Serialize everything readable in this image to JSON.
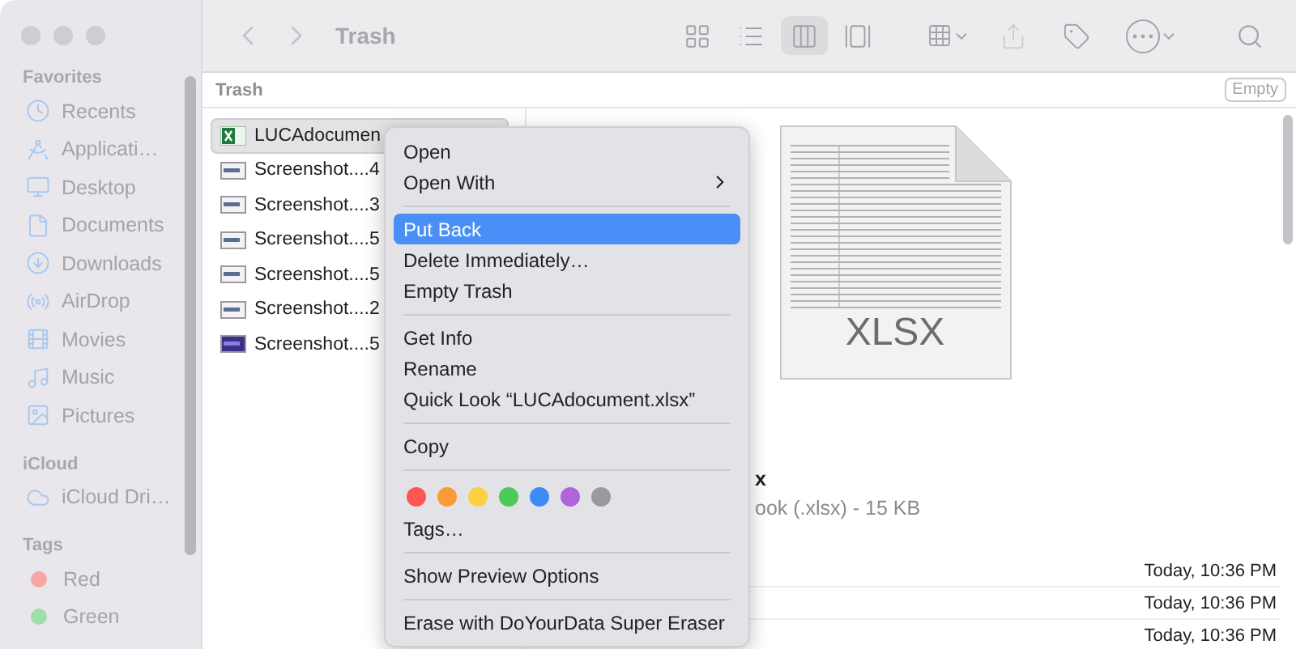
{
  "window": {
    "title": "Trash"
  },
  "toolbar": {
    "views": [
      {
        "kind": "icons",
        "selected": false
      },
      {
        "kind": "list",
        "selected": false
      },
      {
        "kind": "columns",
        "selected": true
      },
      {
        "kind": "gallery",
        "selected": false
      }
    ]
  },
  "sidebar": {
    "sections": [
      {
        "title": "Favorites",
        "items": [
          {
            "label": "Recents",
            "kind": "recents"
          },
          {
            "label": "Applicati…",
            "kind": "applications"
          },
          {
            "label": "Desktop",
            "kind": "desktop"
          },
          {
            "label": "Documents",
            "kind": "documents"
          },
          {
            "label": "Downloads",
            "kind": "downloads"
          },
          {
            "label": "AirDrop",
            "kind": "airdrop"
          },
          {
            "label": "Movies",
            "kind": "movies"
          },
          {
            "label": "Music",
            "kind": "music"
          },
          {
            "label": "Pictures",
            "kind": "pictures"
          }
        ]
      },
      {
        "title": "iCloud",
        "items": [
          {
            "label": "iCloud Dri…",
            "kind": "cloud"
          }
        ]
      },
      {
        "title": "Tags",
        "items": [
          {
            "label": "Red",
            "kind": "tag",
            "color": "#f7a5a5"
          },
          {
            "label": "Green",
            "kind": "tag",
            "color": "#9fdea8"
          }
        ]
      }
    ]
  },
  "path_bar": {
    "title": "Trash",
    "button": "Empty"
  },
  "files": [
    {
      "name": "LUCAdocumen",
      "kind": "spreadsheet",
      "selected": true
    },
    {
      "name": "Screenshot....4",
      "kind": "screenshot",
      "selected": false
    },
    {
      "name": "Screenshot....3",
      "kind": "screenshot",
      "selected": false
    },
    {
      "name": "Screenshot....5",
      "kind": "screenshot",
      "selected": false
    },
    {
      "name": "Screenshot....5",
      "kind": "screenshot",
      "selected": false
    },
    {
      "name": "Screenshot....2",
      "kind": "screenshot",
      "selected": false
    },
    {
      "name": "Screenshot....5",
      "kind": "screenshot-dark",
      "selected": false
    }
  ],
  "preview": {
    "icon_label": "XLSX",
    "name": "x",
    "info": "ook (.xlsx) - 15 KB",
    "dates": [
      "Today, 10:36 PM",
      "Today, 10:36 PM",
      "Today, 10:36 PM"
    ]
  },
  "context_menu": {
    "items": [
      {
        "kind": "item",
        "label": "Open",
        "selected": false
      },
      {
        "kind": "submenu",
        "label": "Open With",
        "selected": false
      },
      {
        "kind": "separator"
      },
      {
        "kind": "item",
        "label": "Put Back",
        "selected": true
      },
      {
        "kind": "item",
        "label": "Delete Immediately…",
        "selected": false
      },
      {
        "kind": "item",
        "label": "Empty Trash",
        "selected": false
      },
      {
        "kind": "separator"
      },
      {
        "kind": "item",
        "label": "Get Info",
        "selected": false
      },
      {
        "kind": "item",
        "label": "Rename",
        "selected": false
      },
      {
        "kind": "item",
        "label": "Quick Look “LUCAdocument.xlsx”",
        "selected": false
      },
      {
        "kind": "separator"
      },
      {
        "kind": "item",
        "label": "Copy",
        "selected": false
      },
      {
        "kind": "separator"
      },
      {
        "kind": "colors",
        "dots": [
          {
            "color": "#fc5753"
          },
          {
            "color": "#fd9a38"
          },
          {
            "color": "#fecf40"
          },
          {
            "color": "#4dcb5a"
          },
          {
            "color": "#3d8bf7"
          },
          {
            "color": "#b065dd"
          },
          {
            "color": "#9a9a9c"
          }
        ]
      },
      {
        "kind": "item",
        "label": "Tags…",
        "selected": false
      },
      {
        "kind": "separator"
      },
      {
        "kind": "item",
        "label": "Show Preview Options",
        "selected": false
      },
      {
        "kind": "separator"
      },
      {
        "kind": "item",
        "label": "Erase with DoYourData Super Eraser",
        "selected": false
      }
    ]
  }
}
